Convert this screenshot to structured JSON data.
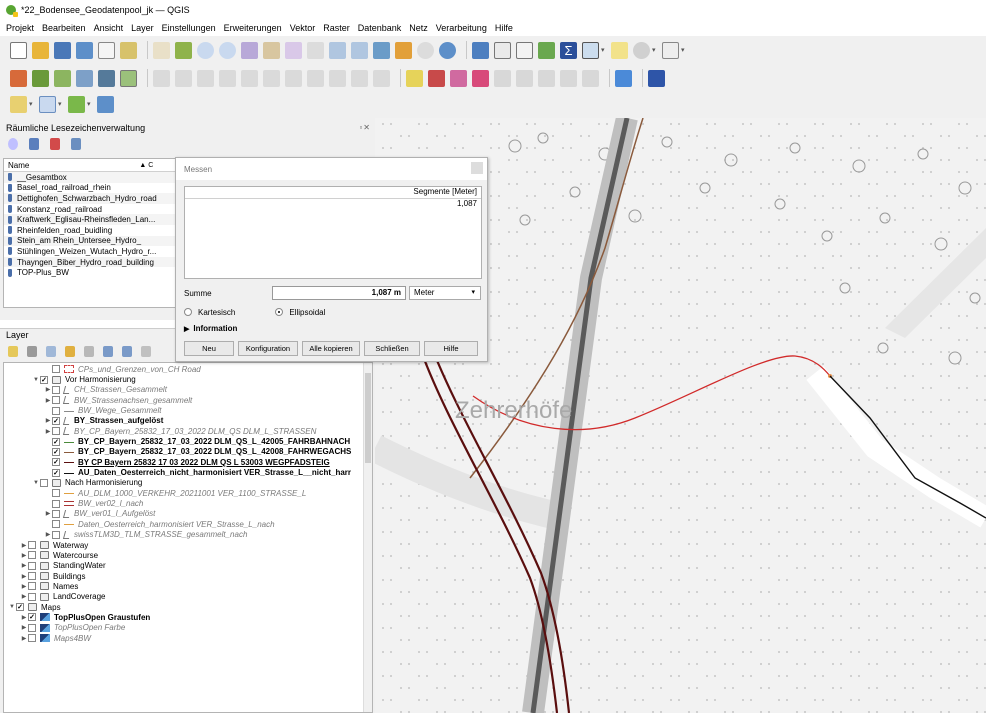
{
  "window": {
    "title": "*22_Bodensee_Geodatenpool_jk — QGIS"
  },
  "menu": [
    "Projekt",
    "Bearbeiten",
    "Ansicht",
    "Layer",
    "Einstellungen",
    "Erweiterungen",
    "Vektor",
    "Raster",
    "Datenbank",
    "Netz",
    "Verarbeitung",
    "Hilfe"
  ],
  "bookmarks_panel": {
    "title": "Räumliche Lesezeichenverwaltung",
    "header_name": "Name",
    "items": [
      "__Gesamtbox",
      "Basel_road_railroad_rhein",
      "Dettighofen_Schwarzbach_Hydro_road",
      "Konstanz_road_railroad",
      "Kraftwerk_Eglisau-Rheinsfleden_Lan...",
      "Rheinfelden_road_buidling",
      "Stein_am Rhein_Untersee_Hydro_",
      "Stühlingen_Weizen_Wutach_Hydro_r...",
      "Thayngen_Biber_Hydro_road_building",
      "TOP-Plus_BW"
    ]
  },
  "layers_panel": {
    "title": "Layer",
    "items": [
      {
        "label": "CPs_und_Grenzen_von_CH Road",
        "indent": 3,
        "checked": false,
        "style": "italic",
        "sym": "dash-red"
      },
      {
        "label": "Vor Harmonisierung",
        "indent": 2,
        "checked": true,
        "style": "normal",
        "sym": "group",
        "expand": "open"
      },
      {
        "label": "CH_Strassen_Gesammelt",
        "indent": 3,
        "checked": false,
        "style": "italic",
        "sym": "multi",
        "expand": "closed"
      },
      {
        "label": "BW_Strassenachsen_gesammelt",
        "indent": 3,
        "checked": false,
        "style": "italic",
        "sym": "multi",
        "expand": "closed"
      },
      {
        "label": "BW_Wege_Gesammelt",
        "indent": 3,
        "checked": false,
        "style": "italic",
        "sym": "line-gray"
      },
      {
        "label": "BY_Strassen_aufgelöst",
        "indent": 3,
        "checked": true,
        "style": "bold",
        "sym": "multi",
        "expand": "closed"
      },
      {
        "label": "BY_CP_Bayern_25832_17_03_2022 DLM_QS DLM_L_STRASSEN",
        "indent": 3,
        "checked": false,
        "style": "italic",
        "sym": "multi",
        "expand": "closed"
      },
      {
        "label": "BY_CP_Bayern_25832_17_03_2022 DLM_QS_L_42005_FAHRBAHNACH",
        "indent": 3,
        "checked": true,
        "style": "bold",
        "sym": "line-green"
      },
      {
        "label": "BY_CP_Bayern_25832_17_03_2022 DLM_QS_L_42008_FAHRWEGACHS",
        "indent": 3,
        "checked": true,
        "style": "bold",
        "sym": "line-brown"
      },
      {
        "label": "BY CP Bayern 25832 17 03 2022 DLM QS L 53003 WEGPFADSTEIG",
        "indent": 3,
        "checked": true,
        "style": "bold-underline",
        "sym": "line-darkred"
      },
      {
        "label": "AU_Daten_Oesterreich_nicht_harmonisiert VER_Strasse_L__nicht_harr",
        "indent": 3,
        "checked": true,
        "style": "bold",
        "sym": "line-black"
      },
      {
        "label": "Nach Harmonisierung",
        "indent": 2,
        "checked": false,
        "style": "normal",
        "sym": "group",
        "expand": "open"
      },
      {
        "label": "AU_DLM_1000_VERKEHR_20211001 VER_1100_STRASSE_L",
        "indent": 3,
        "checked": false,
        "style": "italic",
        "sym": "line-orange"
      },
      {
        "label": "BW_ver02_l_nach",
        "indent": 3,
        "checked": false,
        "style": "italic",
        "sym": "double-red"
      },
      {
        "label": "BW_ver01_l_Aufgelöst",
        "indent": 3,
        "checked": false,
        "style": "italic",
        "sym": "multi",
        "expand": "closed"
      },
      {
        "label": "Daten_Oesterreich_harmonisiert VER_Strasse_L_nach",
        "indent": 3,
        "checked": false,
        "style": "italic",
        "sym": "line-orange"
      },
      {
        "label": "swissTLM3D_TLM_STRASSE_gesammelt_nach",
        "indent": 3,
        "checked": false,
        "style": "italic",
        "sym": "multi",
        "expand": "closed"
      },
      {
        "label": "Waterway",
        "indent": 1,
        "checked": false,
        "style": "normal",
        "sym": "group",
        "expand": "closed"
      },
      {
        "label": "Watercourse",
        "indent": 1,
        "checked": false,
        "style": "normal",
        "sym": "group",
        "expand": "closed"
      },
      {
        "label": "StandingWater",
        "indent": 1,
        "checked": false,
        "style": "normal",
        "sym": "group",
        "expand": "closed"
      },
      {
        "label": "Buildings",
        "indent": 1,
        "checked": false,
        "style": "normal",
        "sym": "group",
        "expand": "closed"
      },
      {
        "label": "Names",
        "indent": 1,
        "checked": false,
        "style": "normal",
        "sym": "group",
        "expand": "closed"
      },
      {
        "label": "LandCoverage",
        "indent": 1,
        "checked": false,
        "style": "normal",
        "sym": "group",
        "expand": "closed"
      },
      {
        "label": "Maps",
        "indent": 0,
        "checked": true,
        "style": "normal",
        "sym": "group",
        "expand": "open"
      },
      {
        "label": "TopPlusOpen Graustufen",
        "indent": 1,
        "checked": true,
        "style": "bold",
        "sym": "raster",
        "expand": "closed"
      },
      {
        "label": "TopPlusOpen Farbe",
        "indent": 1,
        "checked": false,
        "style": "italic",
        "sym": "raster",
        "expand": "closed"
      },
      {
        "label": "Maps4BW",
        "indent": 1,
        "checked": false,
        "style": "italic",
        "sym": "raster",
        "expand": "closed"
      }
    ]
  },
  "measure_dialog": {
    "title": "Messen",
    "col_header": "Segmente [Meter]",
    "segments": [
      "1,087"
    ],
    "sum_label": "Summe",
    "sum_value": "1,087 m",
    "unit": "Meter",
    "radio_cartesian": "Kartesisch",
    "radio_ellipsoidal": "Ellipsoidal",
    "info_label": "Information",
    "buttons": {
      "new": "Neu",
      "config": "Konfiguration",
      "copy_all": "Alle kopieren",
      "close": "Schließen",
      "help": "Hilfe"
    }
  },
  "map": {
    "place_label": "Zehrerhöfe"
  }
}
